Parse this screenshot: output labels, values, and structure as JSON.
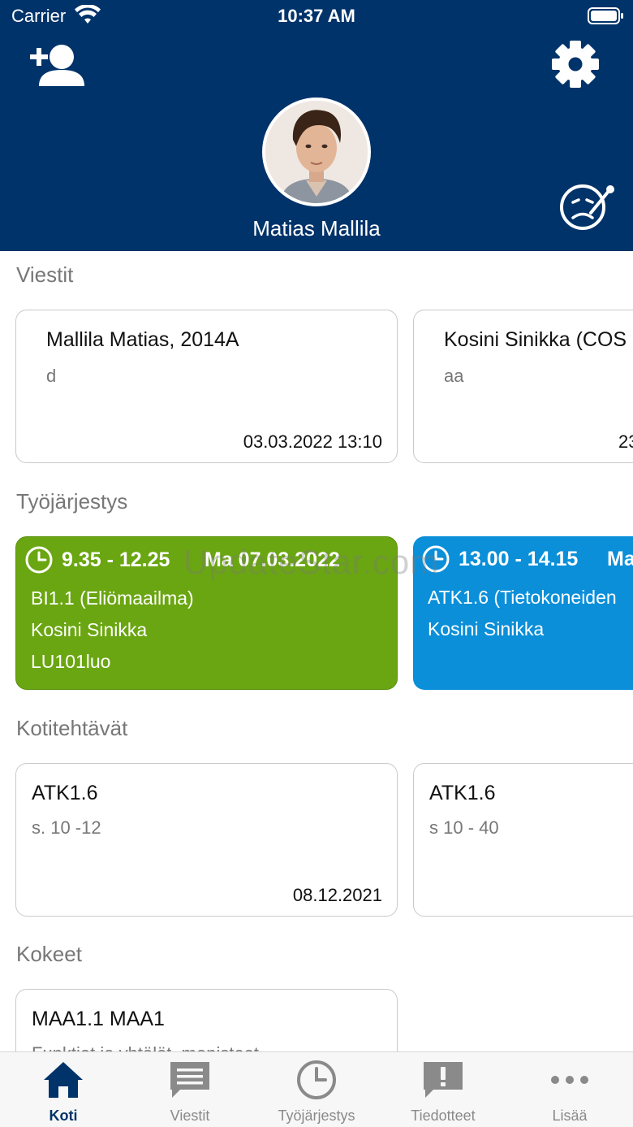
{
  "status_bar": {
    "carrier": "Carrier",
    "time": "10:37 AM"
  },
  "header": {
    "user_name": "Matias Mallila"
  },
  "sections": {
    "messages": "Viestit",
    "schedule": "Työjärjestys",
    "homework": "Kotitehtävät",
    "exams": "Kokeet"
  },
  "messages": [
    {
      "title": "Mallila Matias, 2014A",
      "body": "d",
      "date": "03.03.2022 13:10"
    },
    {
      "title": "Kosini Sinikka (COS",
      "body": "aa",
      "date": "23"
    }
  ],
  "lessons": [
    {
      "time": "9.35 - 12.25",
      "day": "Ma 07.03.2022",
      "course": "BI1.1 (Eliömaailma)",
      "teacher": "Kosini Sinikka",
      "room": "LU101luo",
      "color": "#6aa611"
    },
    {
      "time": "13.00 - 14.15",
      "day": "Ma",
      "course": "ATK1.6 (Tietokoneiden",
      "teacher": "Kosini Sinikka",
      "room": "",
      "color": "#0b8fd9"
    }
  ],
  "homework": [
    {
      "course": "ATK1.6",
      "desc": "s. 10 -12",
      "date": "08.12.2021"
    },
    {
      "course": "ATK1.6",
      "desc": "s 10 - 40",
      "date": ""
    }
  ],
  "exams": [
    {
      "title": "MAA1.1 MAA1",
      "desc": "Funktiot ja yhtälöt, monisteet"
    }
  ],
  "watermark": "UpdateStar.com",
  "tabs": [
    {
      "label": "Koti",
      "icon": "home-icon",
      "active": true
    },
    {
      "label": "Viestit",
      "icon": "message-icon",
      "active": false
    },
    {
      "label": "Työjärjestys",
      "icon": "clock-icon",
      "active": false
    },
    {
      "label": "Tiedotteet",
      "icon": "announcement-icon",
      "active": false
    },
    {
      "label": "Lisää",
      "icon": "more-icon",
      "active": false
    }
  ],
  "colors": {
    "header": "#00336a",
    "active_tab": "#00336a",
    "inactive_tab": "#8a8a8a"
  }
}
